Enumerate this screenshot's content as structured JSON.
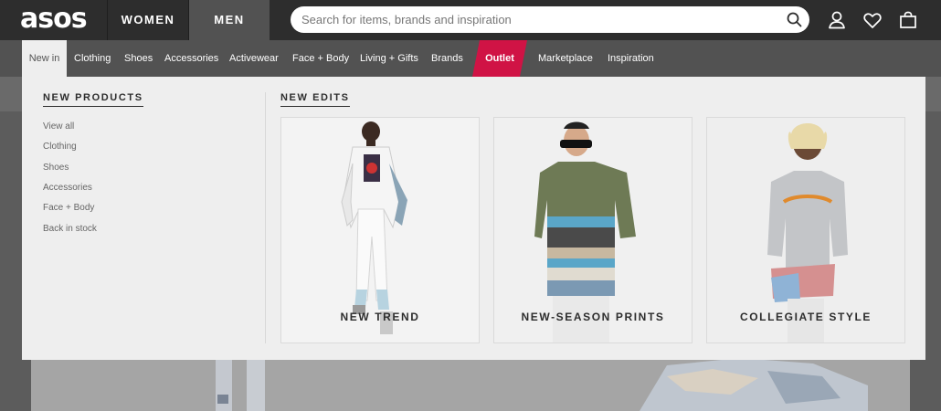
{
  "header": {
    "logo": "asos",
    "gender_tabs": [
      {
        "label": "WOMEN",
        "active": false
      },
      {
        "label": "MEN",
        "active": true
      }
    ],
    "search": {
      "placeholder": "Search for items, brands and inspiration"
    },
    "icons": [
      "search-icon",
      "account-icon",
      "heart-icon",
      "bag-icon"
    ]
  },
  "nav": {
    "items": [
      {
        "label": "New in",
        "active": true
      },
      {
        "label": "Clothing"
      },
      {
        "label": "Shoes"
      },
      {
        "label": "Accessories"
      },
      {
        "label": "Activewear"
      },
      {
        "label": "Face + Body"
      },
      {
        "label": "Living + Gifts"
      },
      {
        "label": "Brands"
      },
      {
        "label": "Outlet",
        "highlight": true
      },
      {
        "label": "Marketplace"
      },
      {
        "label": "Inspiration"
      }
    ]
  },
  "dropdown": {
    "new_products": {
      "title": "NEW PRODUCTS",
      "links": [
        "View all",
        "Clothing",
        "Shoes",
        "Accessories",
        "Face + Body",
        "Back in stock"
      ]
    },
    "new_edits": {
      "title": "NEW EDITS",
      "cards": [
        {
          "label": "NEW TREND"
        },
        {
          "label": "NEW-SEASON PRINTS"
        },
        {
          "label": "COLLEGIATE STYLE"
        }
      ]
    }
  },
  "colors": {
    "topbar": "#2d2d2d",
    "navbar": "#525252",
    "outlet": "#d01345",
    "dropdown_bg": "#eeeeee"
  }
}
